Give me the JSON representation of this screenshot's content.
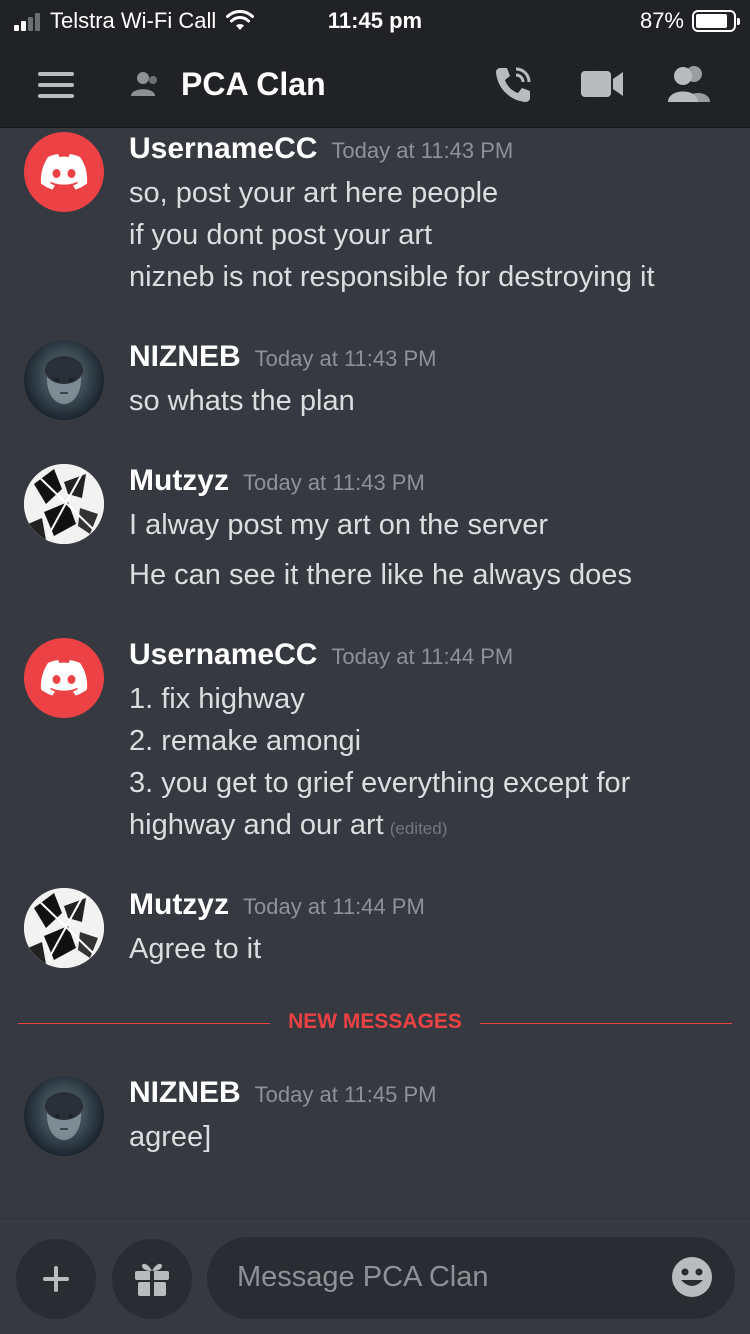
{
  "status_bar": {
    "carrier": "Telstra Wi-Fi Call",
    "time": "11:45 pm",
    "battery": "87%",
    "battery_level": 0.87
  },
  "header": {
    "title": "PCA Clan"
  },
  "messages": [
    {
      "author": "UsernameCC",
      "timestamp": "Today at 11:43 PM",
      "avatar": "discord-logo",
      "lines": [
        "so, post your art here people",
        "if you dont post your art",
        "nizneb is not responsible for destroying it"
      ]
    },
    {
      "author": "NIZNEB",
      "timestamp": "Today at 11:43 PM",
      "avatar": "photo",
      "lines": [
        "so whats the plan"
      ]
    },
    {
      "author": "Mutzyz",
      "timestamp": "Today at 11:43 PM",
      "avatar": "manga",
      "lines": [
        "I alway post my art on the server",
        "He can see it there like he always does"
      ]
    },
    {
      "author": "UsernameCC",
      "timestamp": "Today at 11:44 PM",
      "avatar": "discord-logo",
      "lines": [
        "1. fix highway",
        "2. remake amongi",
        "3. you get to grief everything except for",
        "highway and our art"
      ],
      "edited": "(edited)"
    },
    {
      "author": "Mutzyz",
      "timestamp": "Today at 11:44 PM",
      "avatar": "manga",
      "lines": [
        "Agree to it"
      ]
    },
    {
      "author": "NIZNEB",
      "timestamp": "Today at 11:45 PM",
      "avatar": "photo",
      "lines": [
        "agree]"
      ]
    }
  ],
  "new_messages_divider": "NEW MESSAGES",
  "composer": {
    "placeholder": "Message PCA Clan"
  },
  "colors": {
    "background": "#36393f",
    "header": "#202225",
    "accent_red": "#ed4245",
    "text": "#dcddde",
    "muted": "#8e9297"
  },
  "icons": [
    "signal-icon",
    "wifi-icon",
    "battery-icon",
    "hamburger-menu-icon",
    "dm-person-icon",
    "call-icon",
    "video-icon",
    "members-icon",
    "plus-icon",
    "gift-icon",
    "emoji-icon",
    "discord-logo-icon"
  ]
}
